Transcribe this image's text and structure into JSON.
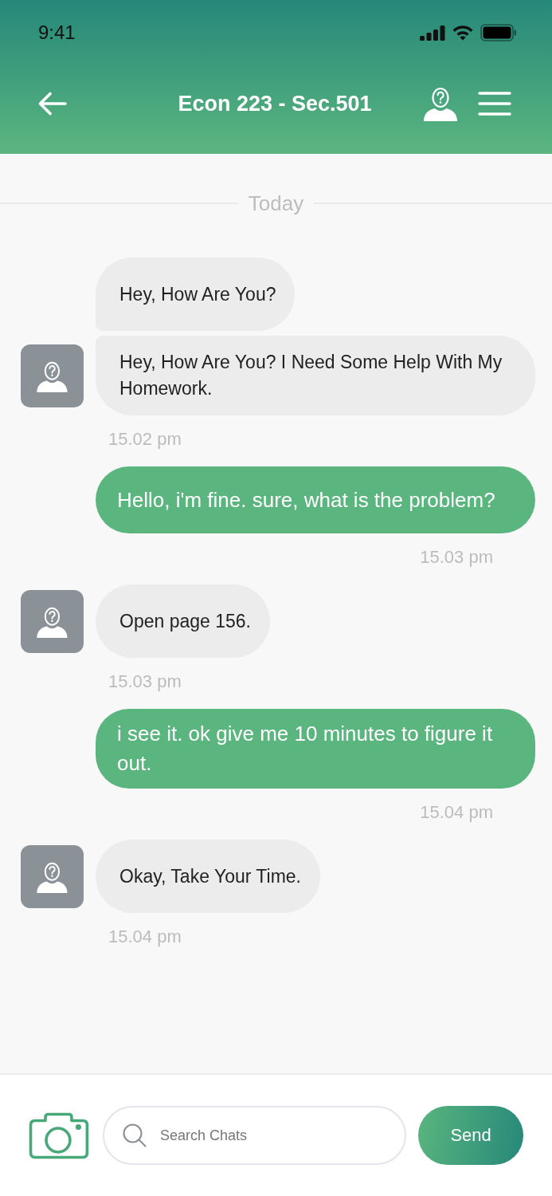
{
  "status_bar": {
    "time": "9:41"
  },
  "header": {
    "title": "Econ 223 - Sec.501"
  },
  "chat": {
    "date_divider": "Today",
    "messages": [
      {
        "kind": "incoming",
        "bubbles": [
          "Hey, How Are You?",
          "Hey, How Are You? I Need Some Help With My Homework."
        ],
        "time": "15.02 pm"
      },
      {
        "kind": "outgoing",
        "bubbles": [
          "Hello, i'm fine. sure, what is the problem?"
        ],
        "time": "15.03 pm"
      },
      {
        "kind": "incoming",
        "bubbles": [
          "Open page 156."
        ],
        "time": "15.03 pm"
      },
      {
        "kind": "outgoing",
        "bubbles": [
          "i see it. ok give me 10 minutes to figure it out."
        ],
        "time": "15.04 pm"
      },
      {
        "kind": "incoming",
        "bubbles": [
          "Okay, Take Your Time."
        ],
        "time": "15.04 pm"
      }
    ]
  },
  "composer": {
    "search": {
      "placeholder": "Search Chats"
    },
    "send_button": "Send"
  }
}
